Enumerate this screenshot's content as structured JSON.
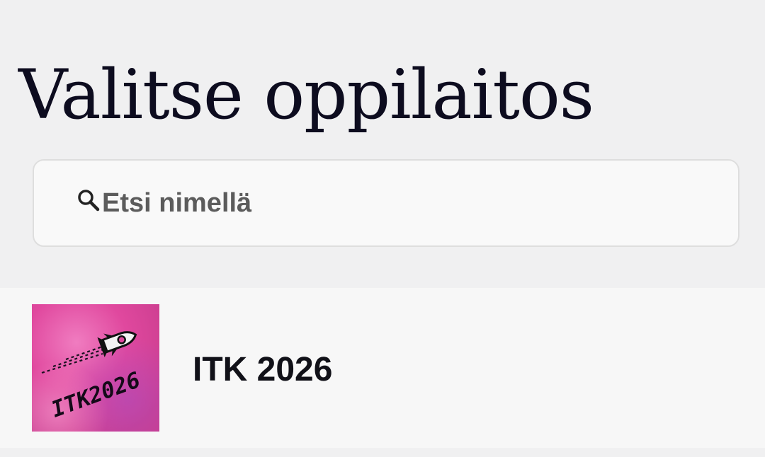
{
  "header": {
    "title": "Valitse oppilaitos"
  },
  "search": {
    "placeholder": "Etsi nimellä",
    "value": "",
    "icon": "search-icon"
  },
  "institutions": [
    {
      "name": "ITK 2026",
      "logo_text": "ITK2026",
      "logo_icon": "rocket-icon"
    }
  ],
  "colors": {
    "background": "#f0f0f1",
    "title_text": "#0d0c1f",
    "list_background": "#f7f7f7",
    "logo_pink": "#e0489e"
  }
}
